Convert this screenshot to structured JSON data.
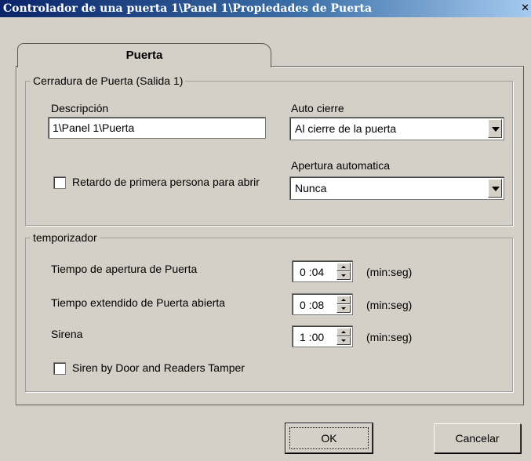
{
  "window": {
    "title": "Controlador de una puerta 1\\Panel  1\\Propiedades de Puerta",
    "close_glyph": "✕"
  },
  "tab": {
    "label": "Puerta"
  },
  "lock_group": {
    "legend": "Cerradura de Puerta (Salida 1)",
    "description_label": "Descripción",
    "description_value": "1\\Panel  1\\Puerta",
    "auto_close_label": "Auto cierre",
    "auto_close_value": "Al cierre de la puerta",
    "auto_open_label": "Apertura automatica",
    "auto_open_value": "Nunca",
    "first_person_delay_label": "Retardo de primera persona para abrir",
    "first_person_delay_checked": false
  },
  "timer_group": {
    "legend": "temporizador",
    "rows": [
      {
        "label": "Tiempo de apertura de Puerta",
        "value": "0 :04",
        "unit": "(min:seg)"
      },
      {
        "label": "Tiempo extendido de Puerta abierta",
        "value": "0 :08",
        "unit": "(min:seg)"
      },
      {
        "label": "Sirena",
        "value": "1 :00",
        "unit": "(min:seg)"
      }
    ],
    "siren_tamper_label": "Siren by Door and Readers Tamper",
    "siren_tamper_checked": false
  },
  "buttons": {
    "ok": "OK",
    "cancel": "Cancelar"
  }
}
